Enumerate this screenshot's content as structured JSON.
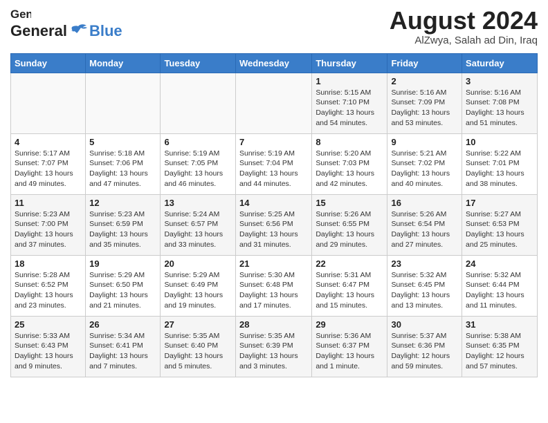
{
  "header": {
    "logo_general": "General",
    "logo_blue": "Blue",
    "month_year": "August 2024",
    "location": "AlZwya, Salah ad Din, Iraq"
  },
  "calendar": {
    "days_of_week": [
      "Sunday",
      "Monday",
      "Tuesday",
      "Wednesday",
      "Thursday",
      "Friday",
      "Saturday"
    ],
    "weeks": [
      [
        {
          "day": "",
          "info": ""
        },
        {
          "day": "",
          "info": ""
        },
        {
          "day": "",
          "info": ""
        },
        {
          "day": "",
          "info": ""
        },
        {
          "day": "1",
          "info": "Sunrise: 5:15 AM\nSunset: 7:10 PM\nDaylight: 13 hours\nand 54 minutes."
        },
        {
          "day": "2",
          "info": "Sunrise: 5:16 AM\nSunset: 7:09 PM\nDaylight: 13 hours\nand 53 minutes."
        },
        {
          "day": "3",
          "info": "Sunrise: 5:16 AM\nSunset: 7:08 PM\nDaylight: 13 hours\nand 51 minutes."
        }
      ],
      [
        {
          "day": "4",
          "info": "Sunrise: 5:17 AM\nSunset: 7:07 PM\nDaylight: 13 hours\nand 49 minutes."
        },
        {
          "day": "5",
          "info": "Sunrise: 5:18 AM\nSunset: 7:06 PM\nDaylight: 13 hours\nand 47 minutes."
        },
        {
          "day": "6",
          "info": "Sunrise: 5:19 AM\nSunset: 7:05 PM\nDaylight: 13 hours\nand 46 minutes."
        },
        {
          "day": "7",
          "info": "Sunrise: 5:19 AM\nSunset: 7:04 PM\nDaylight: 13 hours\nand 44 minutes."
        },
        {
          "day": "8",
          "info": "Sunrise: 5:20 AM\nSunset: 7:03 PM\nDaylight: 13 hours\nand 42 minutes."
        },
        {
          "day": "9",
          "info": "Sunrise: 5:21 AM\nSunset: 7:02 PM\nDaylight: 13 hours\nand 40 minutes."
        },
        {
          "day": "10",
          "info": "Sunrise: 5:22 AM\nSunset: 7:01 PM\nDaylight: 13 hours\nand 38 minutes."
        }
      ],
      [
        {
          "day": "11",
          "info": "Sunrise: 5:23 AM\nSunset: 7:00 PM\nDaylight: 13 hours\nand 37 minutes."
        },
        {
          "day": "12",
          "info": "Sunrise: 5:23 AM\nSunset: 6:59 PM\nDaylight: 13 hours\nand 35 minutes."
        },
        {
          "day": "13",
          "info": "Sunrise: 5:24 AM\nSunset: 6:57 PM\nDaylight: 13 hours\nand 33 minutes."
        },
        {
          "day": "14",
          "info": "Sunrise: 5:25 AM\nSunset: 6:56 PM\nDaylight: 13 hours\nand 31 minutes."
        },
        {
          "day": "15",
          "info": "Sunrise: 5:26 AM\nSunset: 6:55 PM\nDaylight: 13 hours\nand 29 minutes."
        },
        {
          "day": "16",
          "info": "Sunrise: 5:26 AM\nSunset: 6:54 PM\nDaylight: 13 hours\nand 27 minutes."
        },
        {
          "day": "17",
          "info": "Sunrise: 5:27 AM\nSunset: 6:53 PM\nDaylight: 13 hours\nand 25 minutes."
        }
      ],
      [
        {
          "day": "18",
          "info": "Sunrise: 5:28 AM\nSunset: 6:52 PM\nDaylight: 13 hours\nand 23 minutes."
        },
        {
          "day": "19",
          "info": "Sunrise: 5:29 AM\nSunset: 6:50 PM\nDaylight: 13 hours\nand 21 minutes."
        },
        {
          "day": "20",
          "info": "Sunrise: 5:29 AM\nSunset: 6:49 PM\nDaylight: 13 hours\nand 19 minutes."
        },
        {
          "day": "21",
          "info": "Sunrise: 5:30 AM\nSunset: 6:48 PM\nDaylight: 13 hours\nand 17 minutes."
        },
        {
          "day": "22",
          "info": "Sunrise: 5:31 AM\nSunset: 6:47 PM\nDaylight: 13 hours\nand 15 minutes."
        },
        {
          "day": "23",
          "info": "Sunrise: 5:32 AM\nSunset: 6:45 PM\nDaylight: 13 hours\nand 13 minutes."
        },
        {
          "day": "24",
          "info": "Sunrise: 5:32 AM\nSunset: 6:44 PM\nDaylight: 13 hours\nand 11 minutes."
        }
      ],
      [
        {
          "day": "25",
          "info": "Sunrise: 5:33 AM\nSunset: 6:43 PM\nDaylight: 13 hours\nand 9 minutes."
        },
        {
          "day": "26",
          "info": "Sunrise: 5:34 AM\nSunset: 6:41 PM\nDaylight: 13 hours\nand 7 minutes."
        },
        {
          "day": "27",
          "info": "Sunrise: 5:35 AM\nSunset: 6:40 PM\nDaylight: 13 hours\nand 5 minutes."
        },
        {
          "day": "28",
          "info": "Sunrise: 5:35 AM\nSunset: 6:39 PM\nDaylight: 13 hours\nand 3 minutes."
        },
        {
          "day": "29",
          "info": "Sunrise: 5:36 AM\nSunset: 6:37 PM\nDaylight: 13 hours\nand 1 minute."
        },
        {
          "day": "30",
          "info": "Sunrise: 5:37 AM\nSunset: 6:36 PM\nDaylight: 12 hours\nand 59 minutes."
        },
        {
          "day": "31",
          "info": "Sunrise: 5:38 AM\nSunset: 6:35 PM\nDaylight: 12 hours\nand 57 minutes."
        }
      ]
    ]
  }
}
